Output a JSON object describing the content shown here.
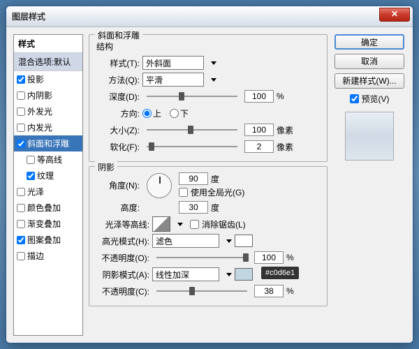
{
  "window": {
    "title": "图层样式"
  },
  "sidebar": {
    "header": "样式",
    "blend_default": "混合选项:默认",
    "items": [
      {
        "label": "投影",
        "checked": true
      },
      {
        "label": "内阴影",
        "checked": false
      },
      {
        "label": "外发光",
        "checked": false
      },
      {
        "label": "内发光",
        "checked": false
      },
      {
        "label": "斜面和浮雕",
        "checked": true,
        "active": true
      },
      {
        "label": "等高线",
        "checked": false,
        "sub": true
      },
      {
        "label": "纹理",
        "checked": true,
        "sub": true
      },
      {
        "label": "光泽",
        "checked": false
      },
      {
        "label": "颜色叠加",
        "checked": false
      },
      {
        "label": "渐变叠加",
        "checked": false
      },
      {
        "label": "图案叠加",
        "checked": true
      },
      {
        "label": "描边",
        "checked": false
      }
    ]
  },
  "bevel": {
    "group_title": "斜面和浮雕",
    "structure_title": "结构",
    "style_label": "样式(T):",
    "style_value": "外斜面",
    "technique_label": "方法(Q):",
    "technique_value": "平滑",
    "depth_label": "深度(D):",
    "depth_value": "100",
    "pct": "%",
    "direction_label": "方向:",
    "dir_up": "上",
    "dir_down": "下",
    "size_label": "大小(Z):",
    "size_value": "100",
    "px": "像素",
    "soften_label": "软化(F):",
    "soften_value": "2"
  },
  "shading": {
    "title": "阴影",
    "angle_label": "角度(N):",
    "angle_value": "90",
    "deg": "度",
    "global_light": "使用全局光(G)",
    "altitude_label": "高度:",
    "altitude_value": "30",
    "contour_label": "光泽等高线:",
    "antialias": "消除锯齿(L)",
    "hl_mode_label": "高光模式(H):",
    "hl_mode_value": "滤色",
    "hl_color": "#ffffff",
    "hl_opacity_label": "不透明度(O):",
    "hl_opacity_value": "100",
    "sh_mode_label": "阴影模式(A):",
    "sh_mode_value": "线性加深",
    "sh_color": "#c0d6e1",
    "sh_opacity_label": "不透明度(C):",
    "sh_opacity_value": "38"
  },
  "buttons": {
    "ok": "确定",
    "cancel": "取消",
    "new_style": "新建样式(W)...",
    "preview": "预览(V)"
  },
  "tooltip": "#c0d6e1"
}
